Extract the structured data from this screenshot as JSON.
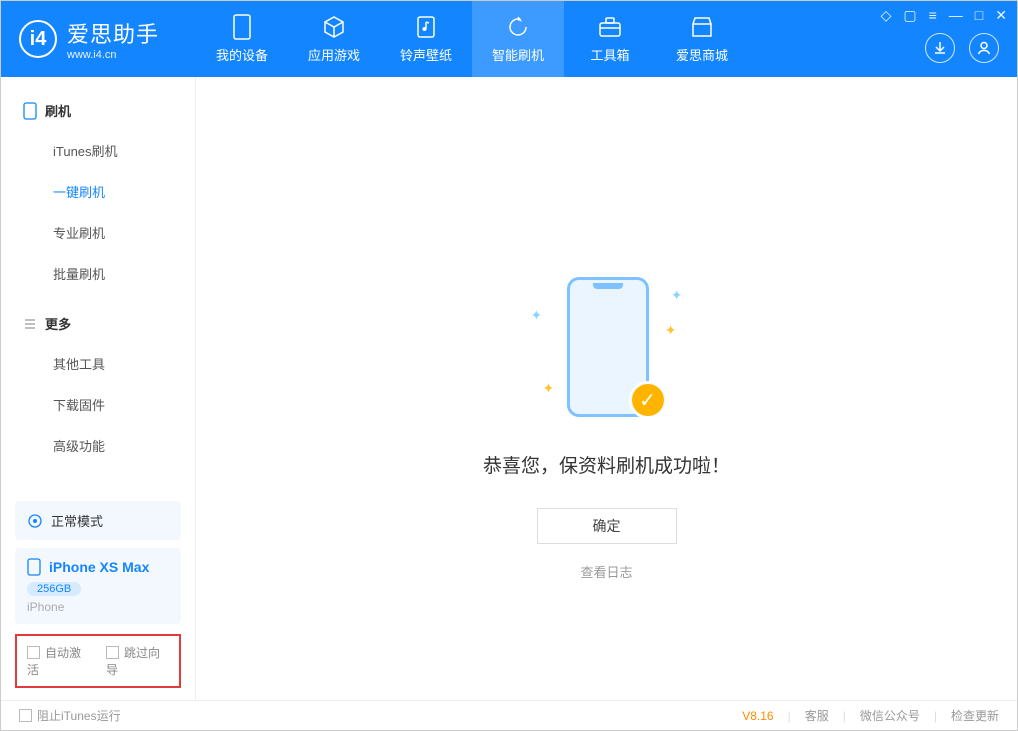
{
  "app": {
    "name": "爱思助手",
    "url": "www.i4.cn"
  },
  "tabs": [
    {
      "label": "我的设备",
      "icon": "device"
    },
    {
      "label": "应用游戏",
      "icon": "cube"
    },
    {
      "label": "铃声壁纸",
      "icon": "music"
    },
    {
      "label": "智能刷机",
      "icon": "refresh",
      "active": true
    },
    {
      "label": "工具箱",
      "icon": "toolbox"
    },
    {
      "label": "爱思商城",
      "icon": "store"
    }
  ],
  "sidebar": {
    "group1": {
      "title": "刷机"
    },
    "items1": [
      {
        "label": "iTunes刷机"
      },
      {
        "label": "一键刷机",
        "active": true
      },
      {
        "label": "专业刷机"
      },
      {
        "label": "批量刷机"
      }
    ],
    "group2": {
      "title": "更多"
    },
    "items2": [
      {
        "label": "其他工具"
      },
      {
        "label": "下载固件"
      },
      {
        "label": "高级功能"
      }
    ]
  },
  "device": {
    "mode": "正常模式",
    "name": "iPhone XS Max",
    "storage": "256GB",
    "type": "iPhone"
  },
  "options": {
    "autoActivate": "自动激活",
    "skipGuide": "跳过向导"
  },
  "main": {
    "success": "恭喜您，保资料刷机成功啦！",
    "ok": "确定",
    "viewLog": "查看日志"
  },
  "footer": {
    "blockItunes": "阻止iTunes运行",
    "version": "V8.16",
    "support": "客服",
    "wechat": "微信公众号",
    "checkUpdate": "检查更新"
  }
}
